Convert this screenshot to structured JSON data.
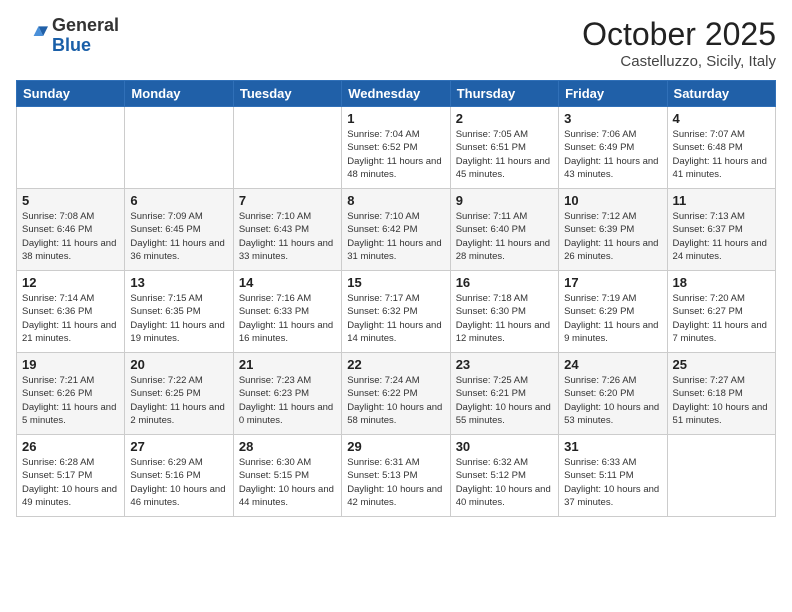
{
  "logo": {
    "general": "General",
    "blue": "Blue"
  },
  "header": {
    "month": "October 2025",
    "location": "Castelluzzo, Sicily, Italy"
  },
  "days_of_week": [
    "Sunday",
    "Monday",
    "Tuesday",
    "Wednesday",
    "Thursday",
    "Friday",
    "Saturday"
  ],
  "weeks": [
    [
      {
        "day": "",
        "info": ""
      },
      {
        "day": "",
        "info": ""
      },
      {
        "day": "",
        "info": ""
      },
      {
        "day": "1",
        "info": "Sunrise: 7:04 AM\nSunset: 6:52 PM\nDaylight: 11 hours\nand 48 minutes."
      },
      {
        "day": "2",
        "info": "Sunrise: 7:05 AM\nSunset: 6:51 PM\nDaylight: 11 hours\nand 45 minutes."
      },
      {
        "day": "3",
        "info": "Sunrise: 7:06 AM\nSunset: 6:49 PM\nDaylight: 11 hours\nand 43 minutes."
      },
      {
        "day": "4",
        "info": "Sunrise: 7:07 AM\nSunset: 6:48 PM\nDaylight: 11 hours\nand 41 minutes."
      }
    ],
    [
      {
        "day": "5",
        "info": "Sunrise: 7:08 AM\nSunset: 6:46 PM\nDaylight: 11 hours\nand 38 minutes."
      },
      {
        "day": "6",
        "info": "Sunrise: 7:09 AM\nSunset: 6:45 PM\nDaylight: 11 hours\nand 36 minutes."
      },
      {
        "day": "7",
        "info": "Sunrise: 7:10 AM\nSunset: 6:43 PM\nDaylight: 11 hours\nand 33 minutes."
      },
      {
        "day": "8",
        "info": "Sunrise: 7:10 AM\nSunset: 6:42 PM\nDaylight: 11 hours\nand 31 minutes."
      },
      {
        "day": "9",
        "info": "Sunrise: 7:11 AM\nSunset: 6:40 PM\nDaylight: 11 hours\nand 28 minutes."
      },
      {
        "day": "10",
        "info": "Sunrise: 7:12 AM\nSunset: 6:39 PM\nDaylight: 11 hours\nand 26 minutes."
      },
      {
        "day": "11",
        "info": "Sunrise: 7:13 AM\nSunset: 6:37 PM\nDaylight: 11 hours\nand 24 minutes."
      }
    ],
    [
      {
        "day": "12",
        "info": "Sunrise: 7:14 AM\nSunset: 6:36 PM\nDaylight: 11 hours\nand 21 minutes."
      },
      {
        "day": "13",
        "info": "Sunrise: 7:15 AM\nSunset: 6:35 PM\nDaylight: 11 hours\nand 19 minutes."
      },
      {
        "day": "14",
        "info": "Sunrise: 7:16 AM\nSunset: 6:33 PM\nDaylight: 11 hours\nand 16 minutes."
      },
      {
        "day": "15",
        "info": "Sunrise: 7:17 AM\nSunset: 6:32 PM\nDaylight: 11 hours\nand 14 minutes."
      },
      {
        "day": "16",
        "info": "Sunrise: 7:18 AM\nSunset: 6:30 PM\nDaylight: 11 hours\nand 12 minutes."
      },
      {
        "day": "17",
        "info": "Sunrise: 7:19 AM\nSunset: 6:29 PM\nDaylight: 11 hours\nand 9 minutes."
      },
      {
        "day": "18",
        "info": "Sunrise: 7:20 AM\nSunset: 6:27 PM\nDaylight: 11 hours\nand 7 minutes."
      }
    ],
    [
      {
        "day": "19",
        "info": "Sunrise: 7:21 AM\nSunset: 6:26 PM\nDaylight: 11 hours\nand 5 minutes."
      },
      {
        "day": "20",
        "info": "Sunrise: 7:22 AM\nSunset: 6:25 PM\nDaylight: 11 hours\nand 2 minutes."
      },
      {
        "day": "21",
        "info": "Sunrise: 7:23 AM\nSunset: 6:23 PM\nDaylight: 11 hours\nand 0 minutes."
      },
      {
        "day": "22",
        "info": "Sunrise: 7:24 AM\nSunset: 6:22 PM\nDaylight: 10 hours\nand 58 minutes."
      },
      {
        "day": "23",
        "info": "Sunrise: 7:25 AM\nSunset: 6:21 PM\nDaylight: 10 hours\nand 55 minutes."
      },
      {
        "day": "24",
        "info": "Sunrise: 7:26 AM\nSunset: 6:20 PM\nDaylight: 10 hours\nand 53 minutes."
      },
      {
        "day": "25",
        "info": "Sunrise: 7:27 AM\nSunset: 6:18 PM\nDaylight: 10 hours\nand 51 minutes."
      }
    ],
    [
      {
        "day": "26",
        "info": "Sunrise: 6:28 AM\nSunset: 5:17 PM\nDaylight: 10 hours\nand 49 minutes."
      },
      {
        "day": "27",
        "info": "Sunrise: 6:29 AM\nSunset: 5:16 PM\nDaylight: 10 hours\nand 46 minutes."
      },
      {
        "day": "28",
        "info": "Sunrise: 6:30 AM\nSunset: 5:15 PM\nDaylight: 10 hours\nand 44 minutes."
      },
      {
        "day": "29",
        "info": "Sunrise: 6:31 AM\nSunset: 5:13 PM\nDaylight: 10 hours\nand 42 minutes."
      },
      {
        "day": "30",
        "info": "Sunrise: 6:32 AM\nSunset: 5:12 PM\nDaylight: 10 hours\nand 40 minutes."
      },
      {
        "day": "31",
        "info": "Sunrise: 6:33 AM\nSunset: 5:11 PM\nDaylight: 10 hours\nand 37 minutes."
      },
      {
        "day": "",
        "info": ""
      }
    ]
  ]
}
